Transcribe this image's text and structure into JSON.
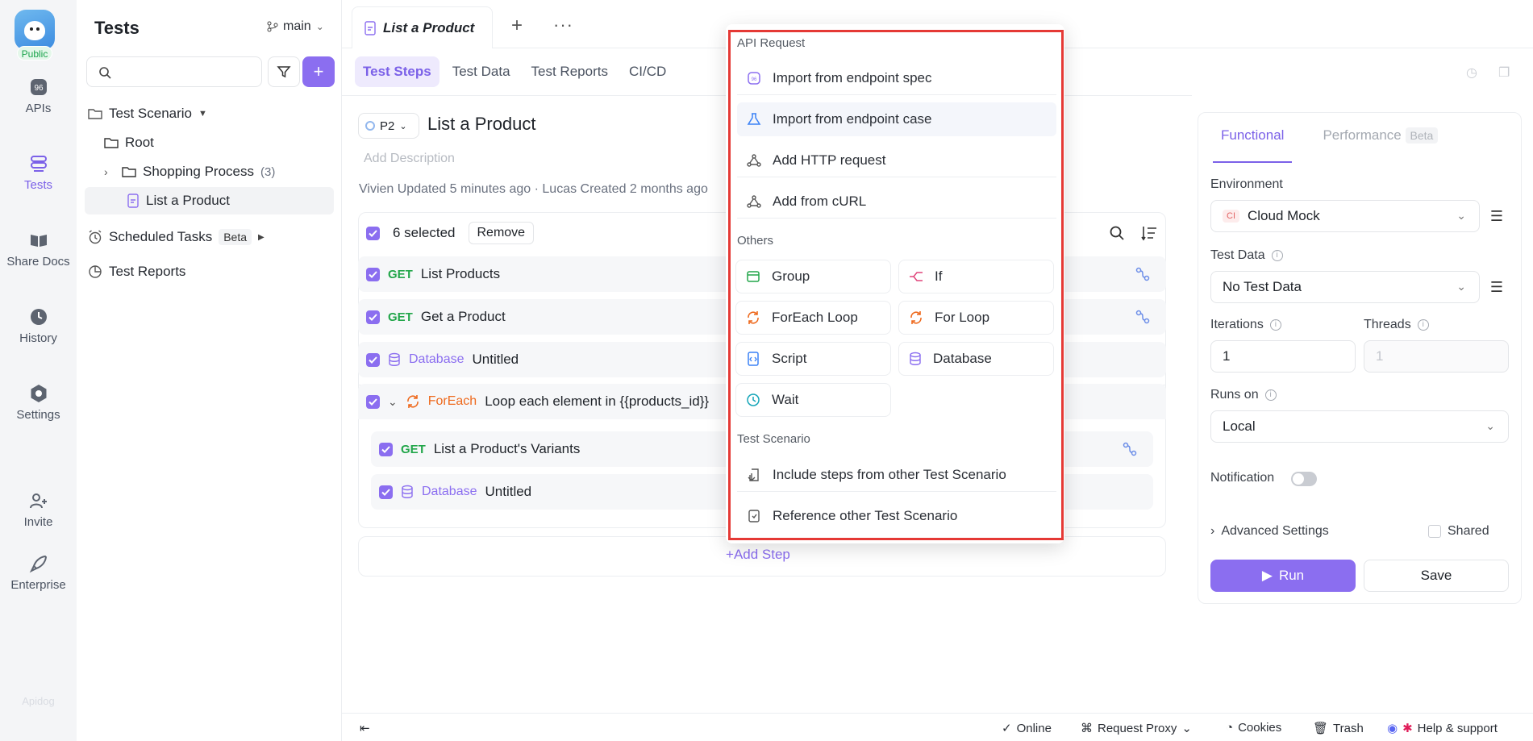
{
  "rail": {
    "public_badge": "Public",
    "items": [
      {
        "label": "APIs",
        "icon": "api-icon"
      },
      {
        "label": "Tests",
        "icon": "tests-icon"
      },
      {
        "label": "Share Docs",
        "icon": "book-icon"
      },
      {
        "label": "History",
        "icon": "history-icon"
      },
      {
        "label": "Settings",
        "icon": "gear-icon"
      },
      {
        "label": "Invite",
        "icon": "add-user-icon"
      },
      {
        "label": "Enterprise",
        "icon": "rocket-icon"
      }
    ],
    "logo_text": "Apidog"
  },
  "sidebar": {
    "title": "Tests",
    "branch": "main",
    "search_placeholder": "",
    "tree": [
      {
        "label": "Test Scenario"
      },
      {
        "label": "Root"
      },
      {
        "label": "Shopping Process",
        "count": "(3)"
      },
      {
        "label": "List a Product"
      },
      {
        "label": "Scheduled Tasks",
        "tag": "Beta"
      },
      {
        "label": "Test Reports"
      }
    ]
  },
  "tabbar": {
    "active_tab": "List a Product"
  },
  "subtabs": [
    "Test Steps",
    "Test Data",
    "Test Reports",
    "CI/CD"
  ],
  "case": {
    "priority": "P2",
    "title": "List a Product",
    "description_placeholder": "Add Description",
    "meta": "Vivien Updated 5 minutes ago · Lucas Created 2 months ago"
  },
  "steps": {
    "selected_text": "6 selected",
    "remove_label": "Remove",
    "rows": [
      {
        "method": "GET",
        "name": "List Products"
      },
      {
        "method": "GET",
        "name": "Get a Product"
      },
      {
        "method": "Database",
        "name": "Untitled"
      },
      {
        "method": "ForEach",
        "name": "Loop each element in {{products_id}}"
      },
      {
        "method": "GET",
        "name": "List a Product's Variants"
      },
      {
        "method": "Database",
        "name": "Untitled"
      }
    ],
    "add_step_label": "Add Step"
  },
  "dropdown": {
    "section_api": "API Request",
    "api_items": [
      "Import from endpoint spec",
      "Import from endpoint case",
      "Add HTTP request",
      "Add from cURL"
    ],
    "section_others": "Others",
    "others": [
      "Group",
      "If",
      "ForEach Loop",
      "For Loop",
      "Script",
      "Database",
      "Wait"
    ],
    "section_scenario": "Test Scenario",
    "scenario_items": [
      "Include steps from other Test Scenario",
      "Reference other Test Scenario"
    ]
  },
  "config": {
    "tab_functional": "Functional",
    "tab_performance": "Performance",
    "performance_tag": "Beta",
    "environment_label": "Environment",
    "environment_tag": "CI",
    "environment_value": "Cloud Mock",
    "test_data_label": "Test Data",
    "test_data_value": "No Test Data",
    "iterations_label": "Iterations",
    "iterations_value": "1",
    "threads_label": "Threads",
    "threads_value": "1",
    "runs_on_label": "Runs on",
    "runs_on_value": "Local",
    "notification_label": "Notification",
    "notification_on": false,
    "advanced_label": "Advanced Settings",
    "shared_label": "Shared",
    "run_label": "Run",
    "save_label": "Save"
  },
  "status": {
    "online": "Online",
    "proxy": "Request Proxy",
    "cookies": "Cookies",
    "trash": "Trash",
    "help": "Help & support"
  },
  "colors": {
    "accent": "#8b6ef0",
    "get": "#22a64a",
    "foreach": "#ee6a1e",
    "highlight_border": "#e53935"
  }
}
